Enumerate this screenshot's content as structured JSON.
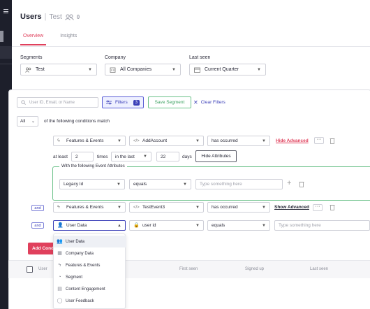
{
  "header": {
    "title": "Users",
    "app_name": "Test",
    "user_count": "0"
  },
  "tabs": [
    {
      "label": "Overview"
    },
    {
      "label": "Insights"
    }
  ],
  "filters_row": {
    "segments_label": "Segments",
    "segments_value": "Test",
    "company_label": "Company",
    "company_value": "All Companies",
    "last_seen_label": "Last seen",
    "last_seen_value": "Current Quarter"
  },
  "toolbar": {
    "search_placeholder": "User ID, Email, or Name",
    "filters_label": "Filters",
    "filters_count": "3",
    "save_segment_label": "Save Segment",
    "clear_filters_label": "Clear Filters"
  },
  "match": {
    "operator": "All",
    "text": "of the following conditions match"
  },
  "condition1": {
    "type": "Features & Events",
    "event": "AddAccount",
    "operator": "has occurred",
    "advanced_link": "Hide Advanced",
    "at_least_label": "at least",
    "count": "2",
    "times_label": "times",
    "range": "in the last",
    "days": "22",
    "days_label": "days",
    "hide_attributes_label": "Hide Attributes",
    "attr_title": "With the following Event Attributes",
    "attr_name": "Legacy Id",
    "attr_operator": "equals",
    "attr_placeholder": "Type something here"
  },
  "and_label": "and",
  "condition2": {
    "type": "Features & Events",
    "event": "TestEvent3",
    "operator": "has occurred",
    "advanced_link": "Show Advanced"
  },
  "condition3": {
    "type": "User Data",
    "field": "user id",
    "operator": "equals",
    "placeholder": "Type something here"
  },
  "add_condition_label": "Add Condi",
  "table": {
    "columns": [
      "User",
      "First seen",
      "Signed up",
      "Last seen"
    ]
  },
  "type_menu": {
    "items": [
      {
        "label": "User Data",
        "icon": "user-icon"
      },
      {
        "label": "Company Data",
        "icon": "building-icon"
      },
      {
        "label": "Features & Events",
        "icon": "bolt-icon"
      },
      {
        "label": "Segment",
        "icon": "segment-icon"
      },
      {
        "label": "Content Engagement",
        "icon": "content-icon"
      },
      {
        "label": "User Feedback",
        "icon": "chat-icon"
      }
    ]
  },
  "colors": {
    "accent": "#e0405c",
    "primary": "#3b3fb8",
    "success": "#3aa05f",
    "sidebar": "#1d1f2b"
  }
}
